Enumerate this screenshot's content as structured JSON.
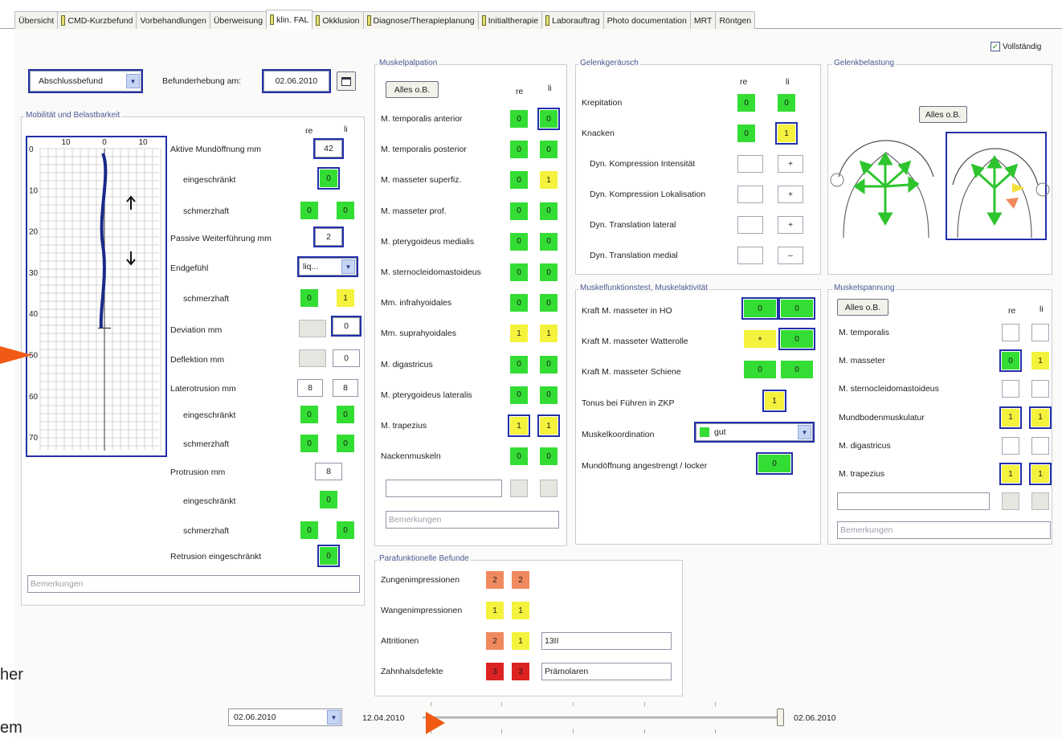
{
  "tabs": [
    {
      "label": "Übersicht",
      "flag": false
    },
    {
      "label": "CMD-Kurzbefund",
      "flag": true
    },
    {
      "label": "Vorbehandlungen",
      "flag": false
    },
    {
      "label": "Überweisung",
      "flag": false
    },
    {
      "label": "klin. FAL",
      "flag": true,
      "active": true
    },
    {
      "label": "Okklusion",
      "flag": true
    },
    {
      "label": "Diagnose/Therapieplanung",
      "flag": true
    },
    {
      "label": "Initialtherapie",
      "flag": true
    },
    {
      "label": "Laborauftrag",
      "flag": true
    },
    {
      "label": "Photo documentation",
      "flag": false
    },
    {
      "label": "MRT",
      "flag": false
    },
    {
      "label": "Röntgen",
      "flag": false
    }
  ],
  "header": {
    "vollstaendig_label": "Vollständig",
    "befundtyp": "Abschlussbefund",
    "befunderhebung_label": "Befunderhebung am:",
    "befunderhebung_date": "02.06.2010"
  },
  "mobilitaet": {
    "title": "Mobilität und Belastbarkeit",
    "col_re": "re",
    "col_li": "li",
    "graph_x_labels": [
      "10",
      "0",
      "10"
    ],
    "graph_y_labels": [
      "0",
      "10",
      "20",
      "30",
      "40",
      "50",
      "60",
      "70"
    ],
    "aktive_label": "Aktive Mundöffnung mm",
    "aktive_value": "42",
    "eingeschraenkt1_label": "eingeschränkt",
    "eingeschraenkt1_value": "0",
    "schmerzhaft1_label": "schmerzhaft",
    "schmerzhaft1_re": "0",
    "schmerzhaft1_li": "0",
    "passive_label": "Passive Weiterführung mm",
    "passive_value": "2",
    "endgefuehl_label": "Endgefühl",
    "endgefuehl_value": "liq...",
    "schmerzhaft2_label": "schmerzhaft",
    "schmerzhaft2_re": "0",
    "schmerzhaft2_li": "1",
    "deviation_label": "Deviation mm",
    "deviation_value": "0",
    "deflektion_label": "Deflektion mm",
    "deflektion_value": "0",
    "laterotrusion_label": "Laterotrusion mm",
    "laterotrusion_re": "8",
    "laterotrusion_li": "8",
    "eingeschraenkt2_label": "eingeschränkt",
    "eingeschraenkt2_re": "0",
    "eingeschraenkt2_li": "0",
    "schmerzhaft3_label": "schmerzhaft",
    "schmerzhaft3_re": "0",
    "schmerzhaft3_li": "0",
    "protrusion_label": "Protrusion mm",
    "protrusion_value": "8",
    "eingeschraenkt3_label": "eingeschränkt",
    "eingeschraenkt3_value": "0",
    "schmerzhaft4_label": "schmerzhaft",
    "schmerzhaft4_re": "0",
    "schmerzhaft4_li": "0",
    "retrusion_label": "Retrusion eingeschränkt",
    "retrusion_value": "0",
    "bemerkungen_placeholder": "Bemerkungen"
  },
  "muskelpalpation": {
    "title": "Muskelpalpation",
    "alles_label": "Alles o.B.",
    "col_re": "re",
    "col_li": "li",
    "rows": [
      {
        "label": "M. temporalis anterior",
        "re": "0",
        "li": "0",
        "re_c": "g",
        "li_c": "g",
        "li_sel": true
      },
      {
        "label": "M. temporalis posterior",
        "re": "0",
        "li": "0",
        "re_c": "g",
        "li_c": "g"
      },
      {
        "label": "M. masseter superfiz.",
        "re": "0",
        "li": "1",
        "re_c": "g",
        "li_c": "y"
      },
      {
        "label": "M. masseter prof.",
        "re": "0",
        "li": "0",
        "re_c": "g",
        "li_c": "g"
      },
      {
        "label": "M. pterygoideus medialis",
        "re": "0",
        "li": "0",
        "re_c": "g",
        "li_c": "g"
      },
      {
        "label": "M. sternocleidomastoideus",
        "re": "0",
        "li": "0",
        "re_c": "g",
        "li_c": "g"
      },
      {
        "label": "Mm. infrahyoidales",
        "re": "0",
        "li": "0",
        "re_c": "g",
        "li_c": "g"
      },
      {
        "label": "Mm. suprahyoidales",
        "re": "1",
        "li": "1",
        "re_c": "y",
        "li_c": "y"
      },
      {
        "label": "M. digastricus",
        "re": "0",
        "li": "0",
        "re_c": "g",
        "li_c": "g"
      },
      {
        "label": "M. pterygoideus lateralis",
        "re": "0",
        "li": "0",
        "re_c": "g",
        "li_c": "g"
      },
      {
        "label": "M. trapezius",
        "re": "1",
        "li": "1",
        "re_c": "y",
        "li_c": "y",
        "re_sel": true,
        "li_sel": true
      },
      {
        "label": "Nackenmuskeln",
        "re": "0",
        "li": "0",
        "re_c": "g",
        "li_c": "g"
      }
    ],
    "bemerkungen_placeholder": "Bemerkungen"
  },
  "gelenkgeraeusch": {
    "title": "Gelenkgeräusch",
    "col_re": "re",
    "col_li": "li",
    "rows": [
      {
        "label": "Krepitation",
        "re": "0",
        "li": "0",
        "re_c": "g",
        "li_c": "g"
      },
      {
        "label": "Knacken",
        "re": "0",
        "li": "1",
        "re_c": "g",
        "li_c": "y",
        "li_sel": true
      },
      {
        "label": "Dyn. Kompression Intensität",
        "re": "",
        "li": "+",
        "re_c": "w",
        "li_c": "w"
      },
      {
        "label": "Dyn. Kompression Lokalisation",
        "re": "",
        "li": "+",
        "re_c": "w",
        "li_c": "w"
      },
      {
        "label": "Dyn. Translation lateral",
        "re": "",
        "li": "+",
        "re_c": "w",
        "li_c": "w"
      },
      {
        "label": "Dyn. Translation medial",
        "re": "",
        "li": "–",
        "re_c": "w",
        "li_c": "w"
      }
    ]
  },
  "gelenkbelastung": {
    "title": "Gelenkbelastung",
    "alles_label": "Alles o.B."
  },
  "muskelfunktion": {
    "title": "Muskelfunktionstest, Muskelaktivität",
    "kraft_ho_label": "Kraft M. masseter in HO",
    "kraft_ho_re": "0",
    "kraft_ho_li": "0",
    "kraft_watte_label": "Kraft M. masseter Watterolle",
    "kraft_watte_re": "+",
    "kraft_watte_li": "0",
    "kraft_schiene_label": "Kraft M. masseter Schiene",
    "kraft_schiene_re": "0",
    "kraft_schiene_li": "0",
    "tonus_label": "Tonus bei Führen in ZKP",
    "tonus_value": "1",
    "koordination_label": "Muskelkoordination",
    "koordination_value": "gut",
    "mundoeffnung_label": "Mundöffnung angestrengt / locker",
    "mundoeffnung_value": "0"
  },
  "muskelspannung": {
    "title": "Muskelspannung",
    "alles_label": "Alles o.B.",
    "col_re": "re",
    "col_li": "li",
    "rows": [
      {
        "label": "M. temporalis",
        "re": "",
        "li": "",
        "re_c": "w",
        "li_c": "w"
      },
      {
        "label": "M. masseter",
        "re": "0",
        "li": "1",
        "re_c": "g",
        "li_c": "y",
        "re_sel": true
      },
      {
        "label": "M. sternocleidomastoideus",
        "re": "",
        "li": "",
        "re_c": "w",
        "li_c": "w"
      },
      {
        "label": "Mundbodenmuskulatur",
        "re": "1",
        "li": "1",
        "re_c": "y",
        "li_c": "y",
        "re_sel": true,
        "li_sel": true
      },
      {
        "label": "M. digastricus",
        "re": "",
        "li": "",
        "re_c": "w",
        "li_c": "w"
      },
      {
        "label": "M. trapezius",
        "re": "1",
        "li": "1",
        "re_c": "y",
        "li_c": "y",
        "re_sel": true,
        "li_sel": true
      }
    ],
    "bemerkungen_placeholder": "Bemerkungen"
  },
  "parafunktionelle": {
    "title": "Parafunktionelle Befunde",
    "rows": [
      {
        "label": "Zungenimpressionen",
        "re": "2",
        "li": "2",
        "re_c": "o",
        "li_c": "o",
        "note": ""
      },
      {
        "label": "Wangenimpressionen",
        "re": "1",
        "li": "1",
        "re_c": "y",
        "li_c": "y",
        "note": ""
      },
      {
        "label": "Attritionen",
        "re": "2",
        "li": "1",
        "re_c": "o",
        "li_c": "y",
        "note": "13II"
      },
      {
        "label": "Zahnhalsdefekte",
        "re": "3",
        "li": "3",
        "re_c": "r",
        "li_c": "r",
        "note": "Prämolaren"
      }
    ]
  },
  "timeline": {
    "selected_date": "02.06.2010",
    "start_date": "12.04.2010",
    "end_date": "02.06.2010"
  },
  "left_fragments": {
    "line1": "her",
    "line2": "em"
  },
  "colors": {
    "green": "#33dd33",
    "yellow": "#f4f23c",
    "orange": "#f08a5e",
    "red": "#dd2222",
    "accent": "#2230a8"
  }
}
